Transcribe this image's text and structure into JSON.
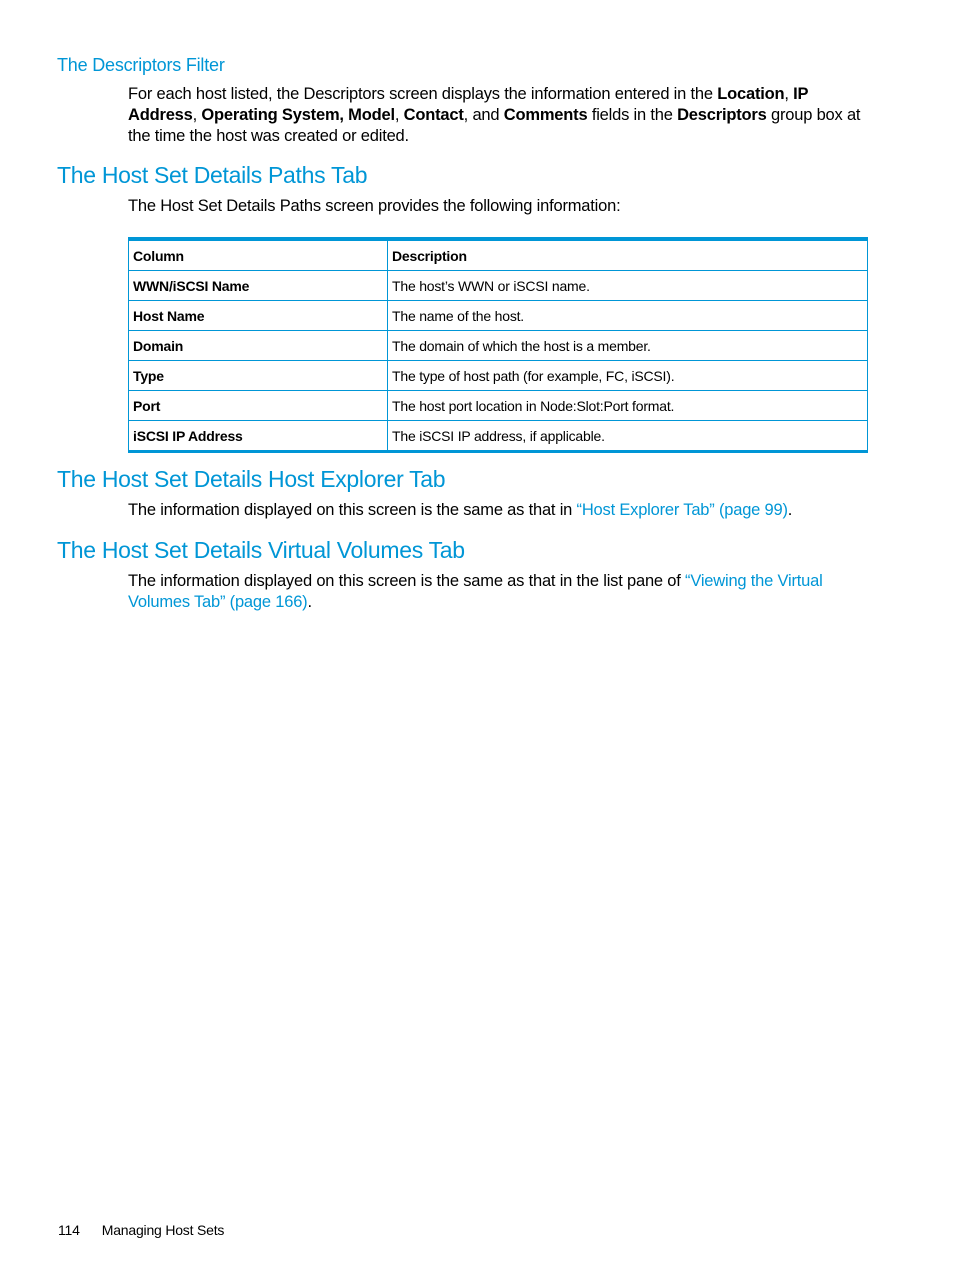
{
  "sections": {
    "descriptors_filter": {
      "heading": "The Descriptors Filter",
      "body": {
        "t1": "For each host listed, the Descriptors screen displays the information entered in the ",
        "b1": "Location",
        "t2": ", ",
        "b2": "IP Address",
        "t3": ", ",
        "b3": "Operating System, Model",
        "t4": ", ",
        "b4": "Contact",
        "t5": ", and ",
        "b5": "Comments",
        "t6": " fields in the ",
        "b6": "Descriptors",
        "t7": " group box at the time the host was created or edited."
      }
    },
    "paths_tab": {
      "heading": "The Host Set Details Paths Tab",
      "intro": "The Host Set Details Paths screen provides the following information:",
      "table": {
        "headers": [
          "Column",
          "Description"
        ],
        "rows": [
          {
            "column": "WWN/iSCSI Name",
            "description": "The host’s WWN or iSCSI name."
          },
          {
            "column": "Host Name",
            "description": "The name of the host."
          },
          {
            "column": "Domain",
            "description": "The domain of which the host is a member."
          },
          {
            "column": "Type",
            "description": "The type of host path (for example, FC, iSCSI)."
          },
          {
            "column": "Port",
            "description": "The host port location in Node:Slot:Port format."
          },
          {
            "column": "iSCSI IP Address",
            "description": "The iSCSI IP address, if applicable."
          }
        ]
      }
    },
    "host_explorer_tab": {
      "heading": "The Host Set Details Host Explorer Tab",
      "body_prefix": "The information displayed on this screen is the same as that in ",
      "link_text": "“Host Explorer Tab” (page 99)",
      "body_suffix": "."
    },
    "virtual_volumes_tab": {
      "heading": "The Host Set Details Virtual Volumes Tab",
      "body_prefix": "The information displayed on this screen is the same as that in the list pane of ",
      "link_text": "“Viewing the Virtual Volumes Tab” (page 166)",
      "body_suffix": "."
    }
  },
  "footer": {
    "page_number": "114",
    "chapter_title": "Managing Host Sets"
  },
  "colors": {
    "accent": "#0096d6",
    "text": "#000000"
  }
}
